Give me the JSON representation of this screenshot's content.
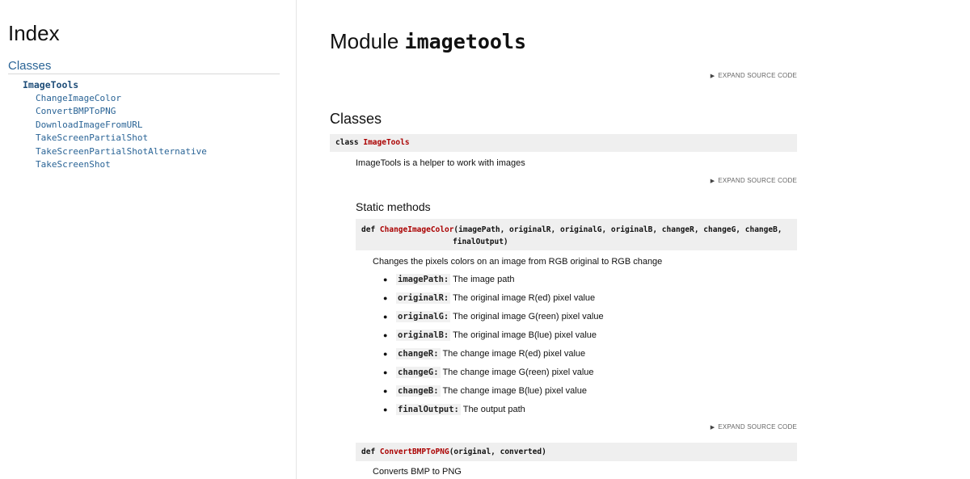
{
  "sidebar": {
    "index_title": "Index",
    "classes_heading": "Classes",
    "class_name": "ImageTools",
    "methods": [
      "ChangeImageColor",
      "ConvertBMPToPNG",
      "DownloadImageFromURL",
      "TakeScreenPartialShot",
      "TakeScreenPartialShotAlternative",
      "TakeScreenShot"
    ]
  },
  "main": {
    "module_prefix": "Module",
    "module_name": "imagetools",
    "expand_label": "EXPAND SOURCE CODE",
    "classes_heading": "Classes",
    "class_sig": {
      "keyword": "class",
      "name": "ImageTools"
    },
    "class_desc": "ImageTools is a helper to work with images",
    "static_methods_heading": "Static methods",
    "method1": {
      "keyword": "def",
      "name": "ChangeImageColor",
      "args_line1": "(imagePath, originalR, originalG, originalB, changeR, changeG, changeB,",
      "args_line2": "finalOutput)",
      "desc": "Changes the pixels colors on an image from RGB original to RGB change",
      "params": [
        {
          "name": "imagePath:",
          "text": "The image path"
        },
        {
          "name": "originalR:",
          "text": "The original image R(ed) pixel value"
        },
        {
          "name": "originalG:",
          "text": "The original image G(reen) pixel value"
        },
        {
          "name": "originalB:",
          "text": "The original image B(lue) pixel value"
        },
        {
          "name": "changeR:",
          "text": "The change image R(ed) pixel value"
        },
        {
          "name": "changeG:",
          "text": "The change image G(reen) pixel value"
        },
        {
          "name": "changeB:",
          "text": "The change image B(lue) pixel value"
        },
        {
          "name": "finalOutput:",
          "text": "The output path"
        }
      ]
    },
    "method2": {
      "keyword": "def",
      "name": "ConvertBMPToPNG",
      "args": "(original, converted)",
      "desc": "Converts BMP to PNG"
    }
  }
}
